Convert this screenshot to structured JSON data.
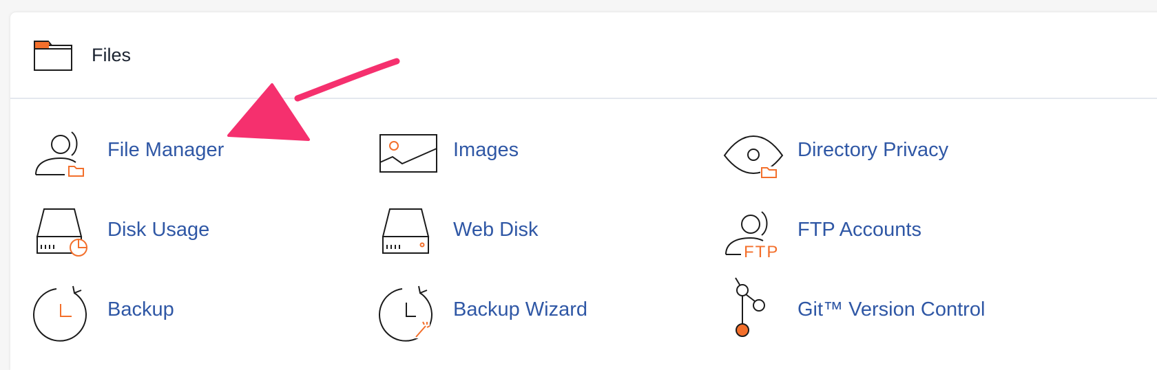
{
  "section": {
    "title": "Files",
    "icon": "folder-icon"
  },
  "tools": {
    "file_manager": {
      "label": "File Manager",
      "icon": "user-folder-icon"
    },
    "images": {
      "label": "Images",
      "icon": "image-icon"
    },
    "directory_privacy": {
      "label": "Directory Privacy",
      "icon": "eye-folder-icon"
    },
    "disk_usage": {
      "label": "Disk Usage",
      "icon": "disk-chart-icon"
    },
    "web_disk": {
      "label": "Web Disk",
      "icon": "hard-drive-icon"
    },
    "ftp_accounts": {
      "label": "FTP Accounts",
      "icon": "user-ftp-icon"
    },
    "ftp_badge": "FTP",
    "backup": {
      "label": "Backup",
      "icon": "clock-restore-icon"
    },
    "backup_wizard": {
      "label": "Backup Wizard",
      "icon": "clock-wand-icon"
    },
    "git_version_control": {
      "label": "Git™ Version Control",
      "icon": "git-branch-icon"
    }
  },
  "annotation": {
    "icon": "pointer-arrow-icon",
    "color": "#f5306e"
  },
  "colors": {
    "accent": "#f36f2b",
    "link": "#2f57a5",
    "icon_stroke": "#1b1b1b",
    "arrow": "#f5306e"
  }
}
